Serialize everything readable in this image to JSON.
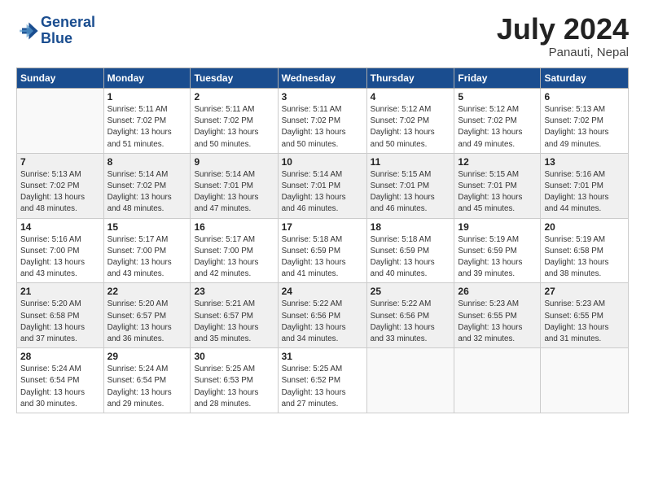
{
  "logo": {
    "line1": "General",
    "line2": "Blue"
  },
  "title": "July 2024",
  "subtitle": "Panauti, Nepal",
  "headers": [
    "Sunday",
    "Monday",
    "Tuesday",
    "Wednesday",
    "Thursday",
    "Friday",
    "Saturday"
  ],
  "weeks": [
    [
      {
        "day": "",
        "sunrise": "",
        "sunset": "",
        "daylight": ""
      },
      {
        "day": "1",
        "sunrise": "Sunrise: 5:11 AM",
        "sunset": "Sunset: 7:02 PM",
        "daylight": "Daylight: 13 hours and 51 minutes."
      },
      {
        "day": "2",
        "sunrise": "Sunrise: 5:11 AM",
        "sunset": "Sunset: 7:02 PM",
        "daylight": "Daylight: 13 hours and 50 minutes."
      },
      {
        "day": "3",
        "sunrise": "Sunrise: 5:11 AM",
        "sunset": "Sunset: 7:02 PM",
        "daylight": "Daylight: 13 hours and 50 minutes."
      },
      {
        "day": "4",
        "sunrise": "Sunrise: 5:12 AM",
        "sunset": "Sunset: 7:02 PM",
        "daylight": "Daylight: 13 hours and 50 minutes."
      },
      {
        "day": "5",
        "sunrise": "Sunrise: 5:12 AM",
        "sunset": "Sunset: 7:02 PM",
        "daylight": "Daylight: 13 hours and 49 minutes."
      },
      {
        "day": "6",
        "sunrise": "Sunrise: 5:13 AM",
        "sunset": "Sunset: 7:02 PM",
        "daylight": "Daylight: 13 hours and 49 minutes."
      }
    ],
    [
      {
        "day": "7",
        "sunrise": "Sunrise: 5:13 AM",
        "sunset": "Sunset: 7:02 PM",
        "daylight": "Daylight: 13 hours and 48 minutes."
      },
      {
        "day": "8",
        "sunrise": "Sunrise: 5:14 AM",
        "sunset": "Sunset: 7:02 PM",
        "daylight": "Daylight: 13 hours and 48 minutes."
      },
      {
        "day": "9",
        "sunrise": "Sunrise: 5:14 AM",
        "sunset": "Sunset: 7:01 PM",
        "daylight": "Daylight: 13 hours and 47 minutes."
      },
      {
        "day": "10",
        "sunrise": "Sunrise: 5:14 AM",
        "sunset": "Sunset: 7:01 PM",
        "daylight": "Daylight: 13 hours and 46 minutes."
      },
      {
        "day": "11",
        "sunrise": "Sunrise: 5:15 AM",
        "sunset": "Sunset: 7:01 PM",
        "daylight": "Daylight: 13 hours and 46 minutes."
      },
      {
        "day": "12",
        "sunrise": "Sunrise: 5:15 AM",
        "sunset": "Sunset: 7:01 PM",
        "daylight": "Daylight: 13 hours and 45 minutes."
      },
      {
        "day": "13",
        "sunrise": "Sunrise: 5:16 AM",
        "sunset": "Sunset: 7:01 PM",
        "daylight": "Daylight: 13 hours and 44 minutes."
      }
    ],
    [
      {
        "day": "14",
        "sunrise": "Sunrise: 5:16 AM",
        "sunset": "Sunset: 7:00 PM",
        "daylight": "Daylight: 13 hours and 43 minutes."
      },
      {
        "day": "15",
        "sunrise": "Sunrise: 5:17 AM",
        "sunset": "Sunset: 7:00 PM",
        "daylight": "Daylight: 13 hours and 43 minutes."
      },
      {
        "day": "16",
        "sunrise": "Sunrise: 5:17 AM",
        "sunset": "Sunset: 7:00 PM",
        "daylight": "Daylight: 13 hours and 42 minutes."
      },
      {
        "day": "17",
        "sunrise": "Sunrise: 5:18 AM",
        "sunset": "Sunset: 6:59 PM",
        "daylight": "Daylight: 13 hours and 41 minutes."
      },
      {
        "day": "18",
        "sunrise": "Sunrise: 5:18 AM",
        "sunset": "Sunset: 6:59 PM",
        "daylight": "Daylight: 13 hours and 40 minutes."
      },
      {
        "day": "19",
        "sunrise": "Sunrise: 5:19 AM",
        "sunset": "Sunset: 6:59 PM",
        "daylight": "Daylight: 13 hours and 39 minutes."
      },
      {
        "day": "20",
        "sunrise": "Sunrise: 5:19 AM",
        "sunset": "Sunset: 6:58 PM",
        "daylight": "Daylight: 13 hours and 38 minutes."
      }
    ],
    [
      {
        "day": "21",
        "sunrise": "Sunrise: 5:20 AM",
        "sunset": "Sunset: 6:58 PM",
        "daylight": "Daylight: 13 hours and 37 minutes."
      },
      {
        "day": "22",
        "sunrise": "Sunrise: 5:20 AM",
        "sunset": "Sunset: 6:57 PM",
        "daylight": "Daylight: 13 hours and 36 minutes."
      },
      {
        "day": "23",
        "sunrise": "Sunrise: 5:21 AM",
        "sunset": "Sunset: 6:57 PM",
        "daylight": "Daylight: 13 hours and 35 minutes."
      },
      {
        "day": "24",
        "sunrise": "Sunrise: 5:22 AM",
        "sunset": "Sunset: 6:56 PM",
        "daylight": "Daylight: 13 hours and 34 minutes."
      },
      {
        "day": "25",
        "sunrise": "Sunrise: 5:22 AM",
        "sunset": "Sunset: 6:56 PM",
        "daylight": "Daylight: 13 hours and 33 minutes."
      },
      {
        "day": "26",
        "sunrise": "Sunrise: 5:23 AM",
        "sunset": "Sunset: 6:55 PM",
        "daylight": "Daylight: 13 hours and 32 minutes."
      },
      {
        "day": "27",
        "sunrise": "Sunrise: 5:23 AM",
        "sunset": "Sunset: 6:55 PM",
        "daylight": "Daylight: 13 hours and 31 minutes."
      }
    ],
    [
      {
        "day": "28",
        "sunrise": "Sunrise: 5:24 AM",
        "sunset": "Sunset: 6:54 PM",
        "daylight": "Daylight: 13 hours and 30 minutes."
      },
      {
        "day": "29",
        "sunrise": "Sunrise: 5:24 AM",
        "sunset": "Sunset: 6:54 PM",
        "daylight": "Daylight: 13 hours and 29 minutes."
      },
      {
        "day": "30",
        "sunrise": "Sunrise: 5:25 AM",
        "sunset": "Sunset: 6:53 PM",
        "daylight": "Daylight: 13 hours and 28 minutes."
      },
      {
        "day": "31",
        "sunrise": "Sunrise: 5:25 AM",
        "sunset": "Sunset: 6:52 PM",
        "daylight": "Daylight: 13 hours and 27 minutes."
      },
      {
        "day": "",
        "sunrise": "",
        "sunset": "",
        "daylight": ""
      },
      {
        "day": "",
        "sunrise": "",
        "sunset": "",
        "daylight": ""
      },
      {
        "day": "",
        "sunrise": "",
        "sunset": "",
        "daylight": ""
      }
    ]
  ]
}
